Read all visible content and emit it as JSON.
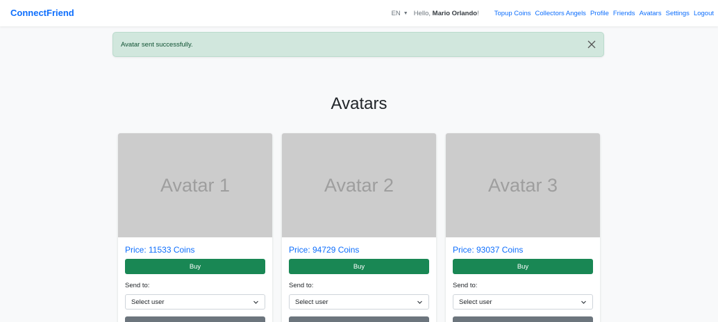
{
  "nav": {
    "brand": "ConnectFriend",
    "language": "EN",
    "greeting_prefix": "Hello, ",
    "user_name": "Mario Orlando",
    "greeting_suffix": "!",
    "links": [
      "Topup Coins",
      "Collectors Angels",
      "Profile",
      "Friends",
      "Avatars",
      "Settings",
      "Logout"
    ]
  },
  "alert": {
    "message": "Avatar sent successfully."
  },
  "page": {
    "title": "Avatars"
  },
  "cards": [
    {
      "image_text": "Avatar 1",
      "price": "Price: 11533 Coins",
      "buy_label": "Buy",
      "send_label": "Send to:",
      "select_value": "Select user"
    },
    {
      "image_text": "Avatar 2",
      "price": "Price: 94729 Coins",
      "buy_label": "Buy",
      "send_label": "Send to:",
      "select_value": "Select user"
    },
    {
      "image_text": "Avatar 3",
      "price": "Price: 93037 Coins",
      "buy_label": "Buy",
      "send_label": "Send to:",
      "select_value": "Select user"
    }
  ],
  "colors": {
    "brand": "#0d6efd",
    "success": "#198754",
    "alert_bg": "#d1e7dd",
    "image_bg": "#cccccc",
    "secondary": "#6c757d"
  },
  "icons": {
    "alert_close": "close-icon",
    "select_chevron": "chevron-down-icon",
    "lang_caret": "caret-down-icon"
  }
}
